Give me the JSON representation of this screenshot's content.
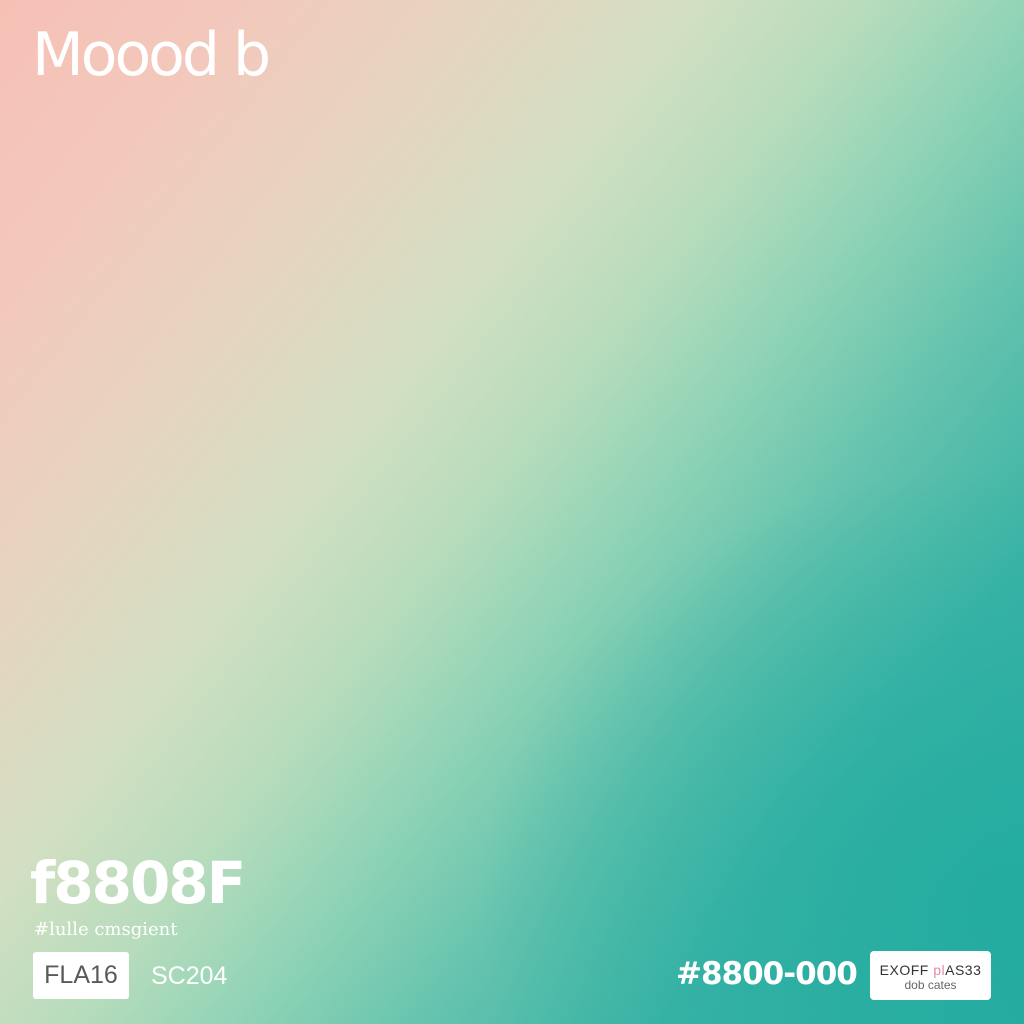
{
  "title": "Moood b",
  "swatch": {
    "hex": "f8808F",
    "caption": "#lulle cmsgient"
  },
  "codes": {
    "boxed": "FLA16",
    "plain": "SC204"
  },
  "footer": {
    "hex_code": "#8800-000"
  },
  "export_button": {
    "line1_main": "EXOFF",
    "line1_accent": " pl",
    "line1_end": "AS33",
    "line2": "dob cates"
  },
  "colors": {
    "gradient_start": "#f7c0b6",
    "gradient_mid": "#b6dcbc",
    "gradient_end": "#2aaca1",
    "accent_pink": "#e38aa3"
  }
}
